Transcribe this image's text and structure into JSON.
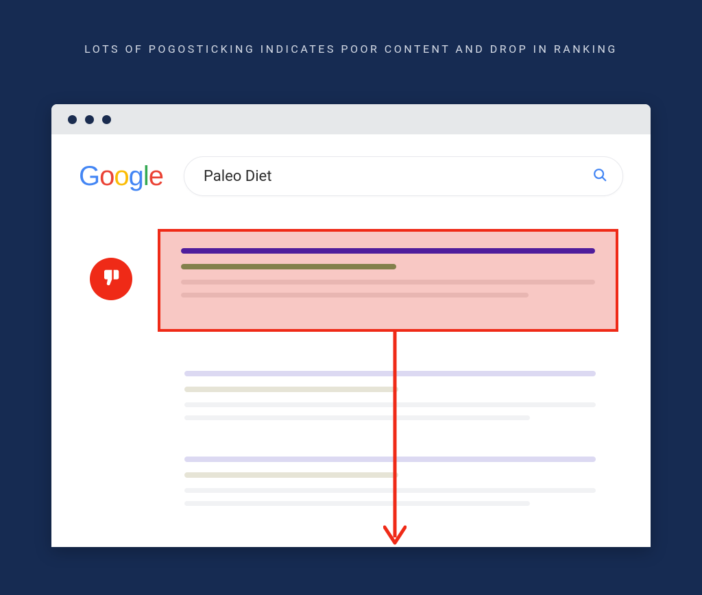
{
  "heading": "LOTS OF POGOSTICKING INDICATES POOR CONTENT AND DROP IN RANKING",
  "logo": {
    "g1": "G",
    "o1": "o",
    "o2": "o",
    "g2": "g",
    "l": "l",
    "e": "e"
  },
  "search": {
    "query": "Paleo Diet"
  },
  "icons": {
    "search": "search-icon",
    "thumb_down": "thumb-down-icon",
    "arrow_down": "arrow-down-icon"
  },
  "colors": {
    "bg": "#162b52",
    "accent_red": "#ef2a17",
    "highlight_fill": "#f8c8c4",
    "link_purple": "#4f1d9c",
    "url_olive": "#83804c"
  }
}
